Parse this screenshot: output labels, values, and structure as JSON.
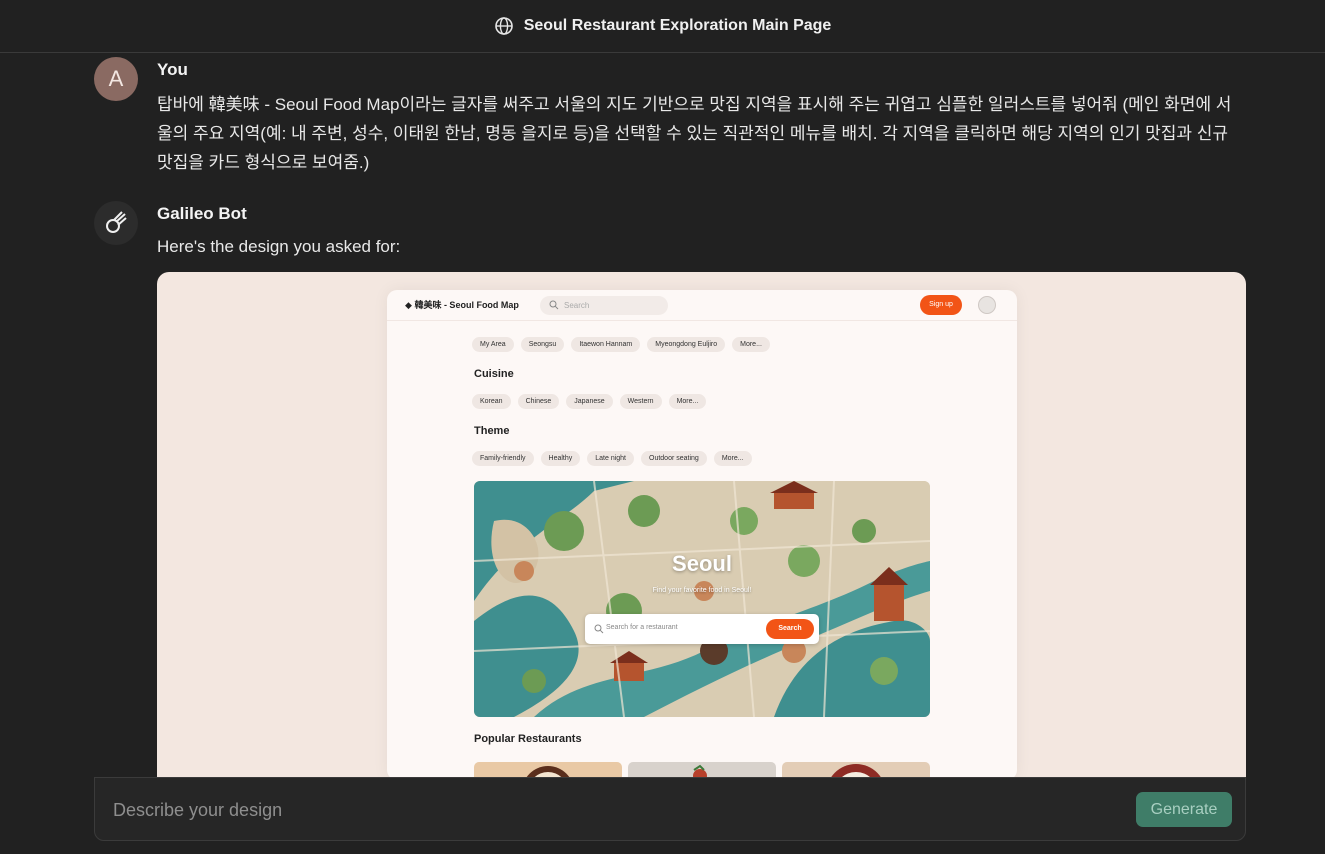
{
  "header": {
    "title": "Seoul Restaurant Exploration Main Page",
    "icon": "globe-icon"
  },
  "user_message": {
    "avatar_letter": "A",
    "name": "You",
    "text": "탑바에 韓美味 - Seoul Food Map이라는 글자를 써주고 서울의 지도 기반으로 맛집 지역을 표시해 주는 귀엽고 심플한 일러스트를 넣어줘 (메인 화면에 서울의 주요 지역(예: 내 주변, 성수, 이태원 한남, 명동 을지로 등)을 선택할 수 있는 직관적인 메뉴를 배치. 각 지역을 클릭하면 해당 지역의 인기 맛집과 신규 맛집을 카드 형식으로 보여줌.)"
  },
  "bot_message": {
    "name": "Galileo Bot",
    "icon": "galileo-logo-icon",
    "text": "Here's the design you asked for:"
  },
  "design_preview": {
    "logo_text": "韓美味 - Seoul Food Map",
    "search_placeholder": "Search",
    "signup_label": "Sign up",
    "area_chips": [
      "My Area",
      "Seongsu",
      "Itaewon Hannam",
      "Myeongdong Euljiro",
      "More..."
    ],
    "cuisine_heading": "Cuisine",
    "cuisine_chips": [
      "Korean",
      "Chinese",
      "Japanese",
      "Western",
      "More..."
    ],
    "theme_heading": "Theme",
    "theme_chips": [
      "Family-friendly",
      "Healthy",
      "Late night",
      "Outdoor seating",
      "More..."
    ],
    "map_title": "Seoul",
    "map_subtitle": "Find your favorite food in Seoul!",
    "map_search_placeholder": "Search for a restaurant",
    "map_search_button": "Search",
    "popular_heading": "Popular Restaurants"
  },
  "composer": {
    "placeholder": "Describe your design",
    "generate_label": "Generate"
  },
  "colors": {
    "background": "#212121",
    "accent_orange": "#f25416",
    "generate_button": "#3f7d68",
    "preview_bg": "#f3e7e0"
  }
}
